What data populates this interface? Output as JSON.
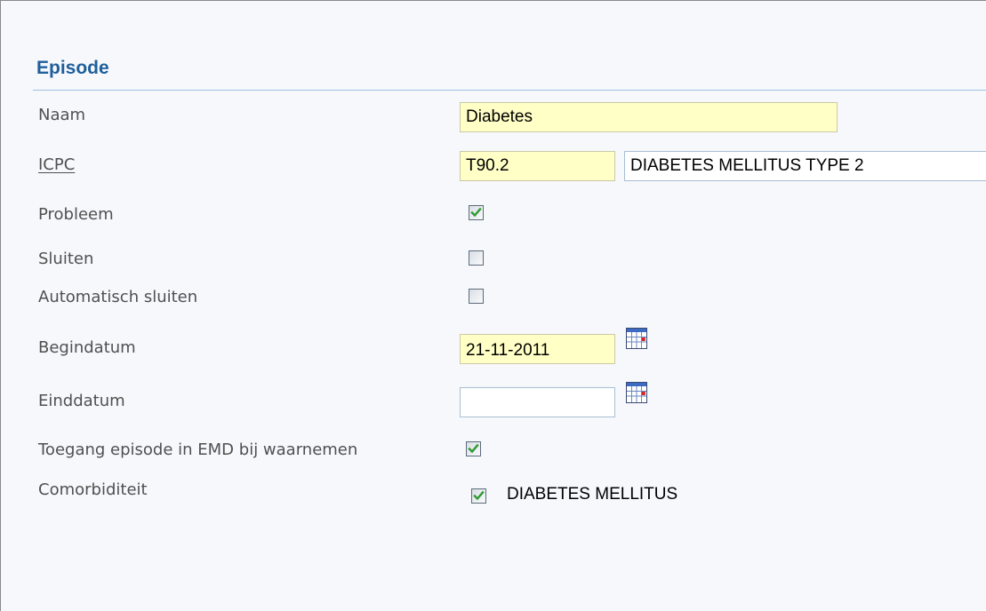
{
  "section": {
    "title": "Episode"
  },
  "fields": {
    "naam": {
      "label": "Naam",
      "value": "Diabetes"
    },
    "icpc": {
      "label": "ICPC",
      "code": "T90.2",
      "description": "DIABETES MELLITUS TYPE 2"
    },
    "probleem": {
      "label": "Probleem",
      "checked": true
    },
    "sluiten": {
      "label": "Sluiten",
      "checked": false
    },
    "automatisch_sluiten": {
      "label": "Automatisch sluiten",
      "checked": false
    },
    "begindatum": {
      "label": "Begindatum",
      "value": "21-11-2011"
    },
    "einddatum": {
      "label": "Einddatum",
      "value": ""
    },
    "toegang": {
      "label": "Toegang episode in EMD bij waarnemen",
      "checked": true
    },
    "comorbiditeit": {
      "label": "Comorbiditeit",
      "items": [
        {
          "label": "DIABETES MELLITUS",
          "checked": true
        }
      ]
    }
  },
  "icons": {
    "calendar": "calendar-icon",
    "check": "checkmark-icon"
  },
  "colors": {
    "title": "#1f5f9c",
    "required_field_bg": "#ffffc6",
    "check_green": "#2f9a33"
  }
}
